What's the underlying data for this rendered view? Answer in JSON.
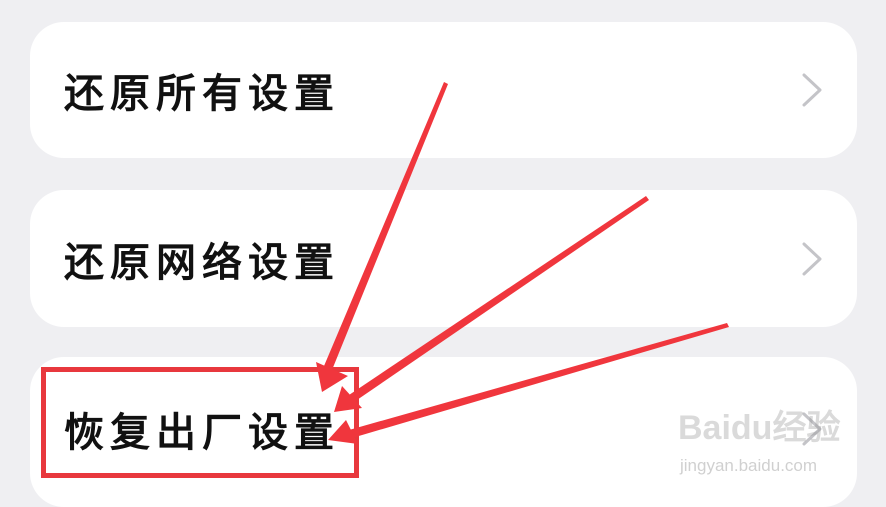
{
  "settings_list": {
    "items": [
      {
        "label": "还原所有设置"
      },
      {
        "label": "还原网络设置"
      },
      {
        "label": "恢复出厂设置"
      }
    ]
  },
  "annotation": {
    "highlight_color": "#e8383d",
    "highlight_target": "恢复出厂设置"
  },
  "watermark": {
    "logo": "Baidu",
    "logo_suffix": "经验",
    "url": "jingyan.baidu.com"
  }
}
